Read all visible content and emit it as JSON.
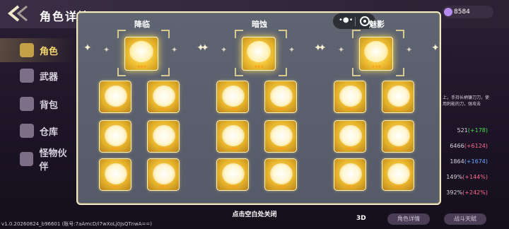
{
  "header": {
    "title": "角色详情"
  },
  "currency": {
    "amount": "8584"
  },
  "sidebar": {
    "items": [
      {
        "label": "角色",
        "active": true
      },
      {
        "label": "武器",
        "active": false
      },
      {
        "label": "背包",
        "active": false
      },
      {
        "label": "仓库",
        "active": false
      },
      {
        "label": "怪物伙伴",
        "active": false
      }
    ]
  },
  "right_panel": {
    "description": "上，手持长柄镰刀刀，使用刺能的刀，强攻击",
    "stats": [
      {
        "base": "521",
        "bonus": "(+178)",
        "tone": "plus"
      },
      {
        "base": "6466",
        "bonus": "(+6124)",
        "tone": "minus"
      },
      {
        "base": "1864",
        "bonus": "(+1674)",
        "tone": "blue"
      },
      {
        "base": "149%",
        "bonus": "(+144%)",
        "tone": "minus"
      },
      {
        "base": "392%",
        "bonus": "(+242%)",
        "tone": "minus"
      }
    ],
    "buttons": [
      "角色详情",
      "战斗天赋"
    ],
    "label_3d": "3D"
  },
  "version": "v1.0.20260824_b96601 (账号:7aAmcD/i7wXoLj0JsQTnwA==)",
  "popup": {
    "columns": [
      {
        "title": "降临",
        "hero_stars": "★★★",
        "skills": [
          "★★★",
          "★★★",
          "★★★",
          "★★★",
          "★★★",
          "★★★"
        ]
      },
      {
        "title": "暗蚀",
        "hero_stars": "★★★",
        "skills": [
          "★★★",
          "★★★",
          "★★★",
          "★★★",
          "★★★",
          "★★★"
        ]
      },
      {
        "title": "魅影",
        "hero_stars": "★★★",
        "skills": [
          "★★★",
          "★★★",
          "★★★",
          "★★★",
          "★★★",
          "★★★"
        ]
      }
    ],
    "close_hint": "点击空白处关闭",
    "sparkle_glyph": "✦"
  },
  "miniprogram_capsule": {
    "menu_glyph": "•●•"
  },
  "colors": {
    "accent_gold": "#f3c437",
    "star": "#ff9a1a",
    "panel": "#5e6472",
    "active_text": "#f5d76e"
  }
}
